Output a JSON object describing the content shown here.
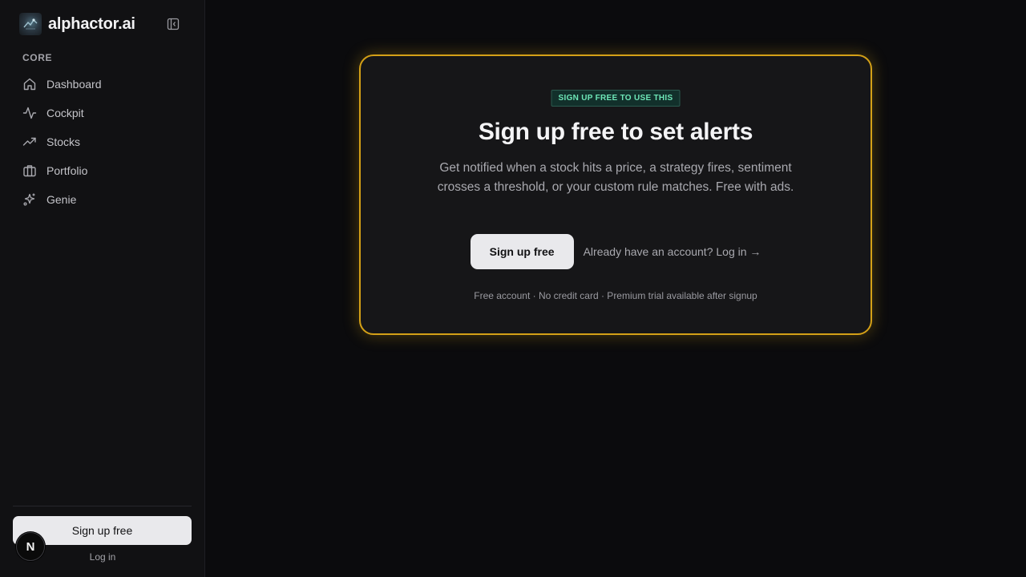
{
  "brand": {
    "name": "alphactor.ai"
  },
  "sidebar": {
    "section_label": "CORE",
    "items": [
      {
        "label": "Dashboard",
        "icon": "home-icon"
      },
      {
        "label": "Cockpit",
        "icon": "activity-icon"
      },
      {
        "label": "Stocks",
        "icon": "trending-up-icon"
      },
      {
        "label": "Portfolio",
        "icon": "briefcase-icon"
      },
      {
        "label": "Genie",
        "icon": "sparkles-icon"
      }
    ],
    "signup_label": "Sign up free",
    "login_label": "Log in",
    "badge_letter": "N"
  },
  "card": {
    "badge": "SIGN UP FREE TO USE THIS",
    "title": "Sign up free to set alerts",
    "description": "Get notified when a stock hits a price, a strategy fires, sentiment crosses a threshold, or your custom rule matches. Free with ads.",
    "cta_label": "Sign up free",
    "login_prompt": "Already have an account? Log in →",
    "fine_print": "Free account · No credit card · Premium trial available after signup"
  },
  "colors": {
    "accent_border": "#d4a017",
    "badge_text": "#6ee7b7",
    "background": "#0b0b0d",
    "sidebar_bg": "#111113"
  }
}
